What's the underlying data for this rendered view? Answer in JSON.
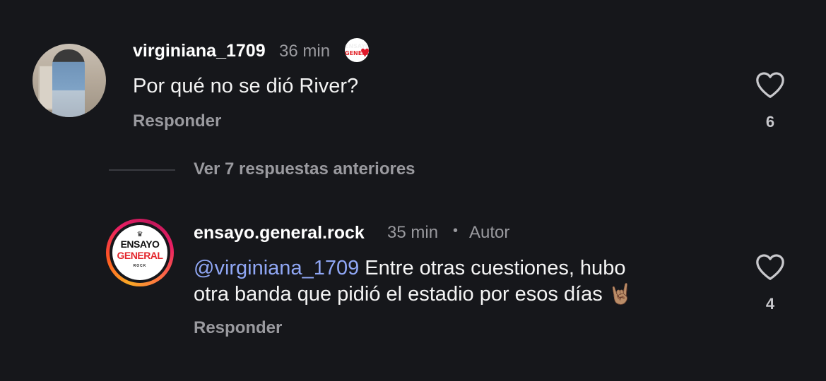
{
  "comments": [
    {
      "username": "virginiana_1709",
      "time": "36 min",
      "text": "Por qué no se dió River?",
      "reply_label": "Responder",
      "likes": "6",
      "badge": {
        "line1": "ENSAYO",
        "line2": "GENERAL"
      }
    },
    {
      "username": "ensayo.general.rock",
      "time": "35 min",
      "separator": "•",
      "role": "Autor",
      "mention": "@virginiana_1709",
      "text_line1": " Entre otras cuestiones, hubo",
      "text_line2": "otra banda que pidió el estadio por esos días",
      "emoji": "🤘🏽",
      "reply_label": "Responder",
      "likes": "4",
      "avatar_logo": {
        "line1": "ENSAYO",
        "line2": "GENERAL",
        "line3": "ROCK"
      }
    }
  ],
  "view_previous_label": "Ver 7 respuestas anteriores",
  "colors": {
    "background": "#16171b",
    "muted_text": "#9a9a9f",
    "mention": "#90a7f5",
    "logo_red": "#e3262c"
  }
}
